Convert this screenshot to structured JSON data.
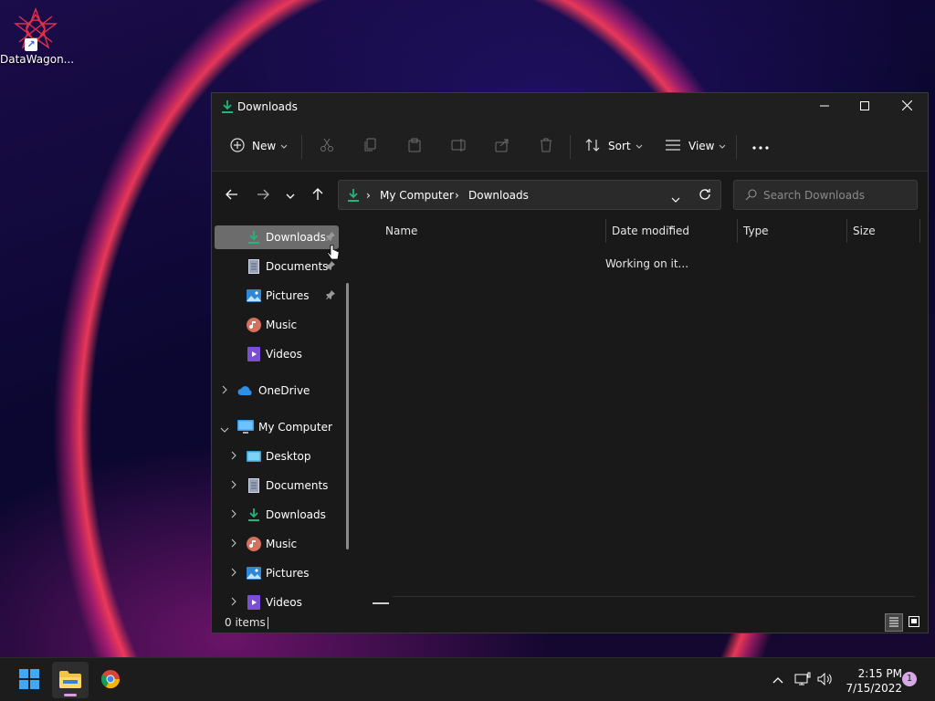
{
  "desktop": {
    "icons": [
      {
        "label": "DataWagon...",
        "icon": "datawagon-logo-icon"
      }
    ]
  },
  "window": {
    "title": "Downloads",
    "controls": {
      "minimize": "minimize-icon",
      "maximize": "maximize-icon",
      "close": "close-icon"
    }
  },
  "toolbar": {
    "new_label": "New",
    "sort_label": "Sort",
    "view_label": "View",
    "disabled_actions": [
      "cut-icon",
      "copy-icon",
      "paste-icon",
      "rename-icon",
      "share-icon",
      "delete-icon"
    ],
    "more": "more-options-icon"
  },
  "address": {
    "crumbs": [
      "My Computer",
      "Downloads"
    ]
  },
  "search": {
    "placeholder": "Search Downloads"
  },
  "sidebar": {
    "quick_access": [
      {
        "label": "Downloads",
        "icon": "download-icon",
        "pinned": true,
        "active": true
      },
      {
        "label": "Documents",
        "icon": "document-icon",
        "pinned": true
      },
      {
        "label": "Pictures",
        "icon": "pictures-icon",
        "pinned": true
      },
      {
        "label": "Music",
        "icon": "music-icon"
      },
      {
        "label": "Videos",
        "icon": "videos-icon"
      }
    ],
    "onedrive": {
      "label": "OneDrive",
      "icon": "cloud-icon"
    },
    "computer": {
      "label": "My Computer",
      "icon": "monitor-icon",
      "children": [
        {
          "label": "Desktop",
          "icon": "desktop-icon"
        },
        {
          "label": "Documents",
          "icon": "document-icon"
        },
        {
          "label": "Downloads",
          "icon": "download-icon"
        },
        {
          "label": "Music",
          "icon": "music-icon"
        },
        {
          "label": "Pictures",
          "icon": "pictures-icon"
        },
        {
          "label": "Videos",
          "icon": "videos-icon"
        }
      ]
    }
  },
  "columns": [
    "Name",
    "Date modified",
    "Type",
    "Size"
  ],
  "content": {
    "status": "Working on it..."
  },
  "statusbar": {
    "count": "0 items"
  },
  "taskbar": {
    "apps": [
      "start-icon",
      "file-explorer-icon",
      "chrome-icon"
    ],
    "clock": {
      "time": "2:15 PM",
      "date": "7/15/2022"
    },
    "notifications": "1"
  },
  "colors": {
    "accent_green": "#1fb77a",
    "folder_blue": "#3a8ee6",
    "active_item": "#6c6c6c"
  }
}
